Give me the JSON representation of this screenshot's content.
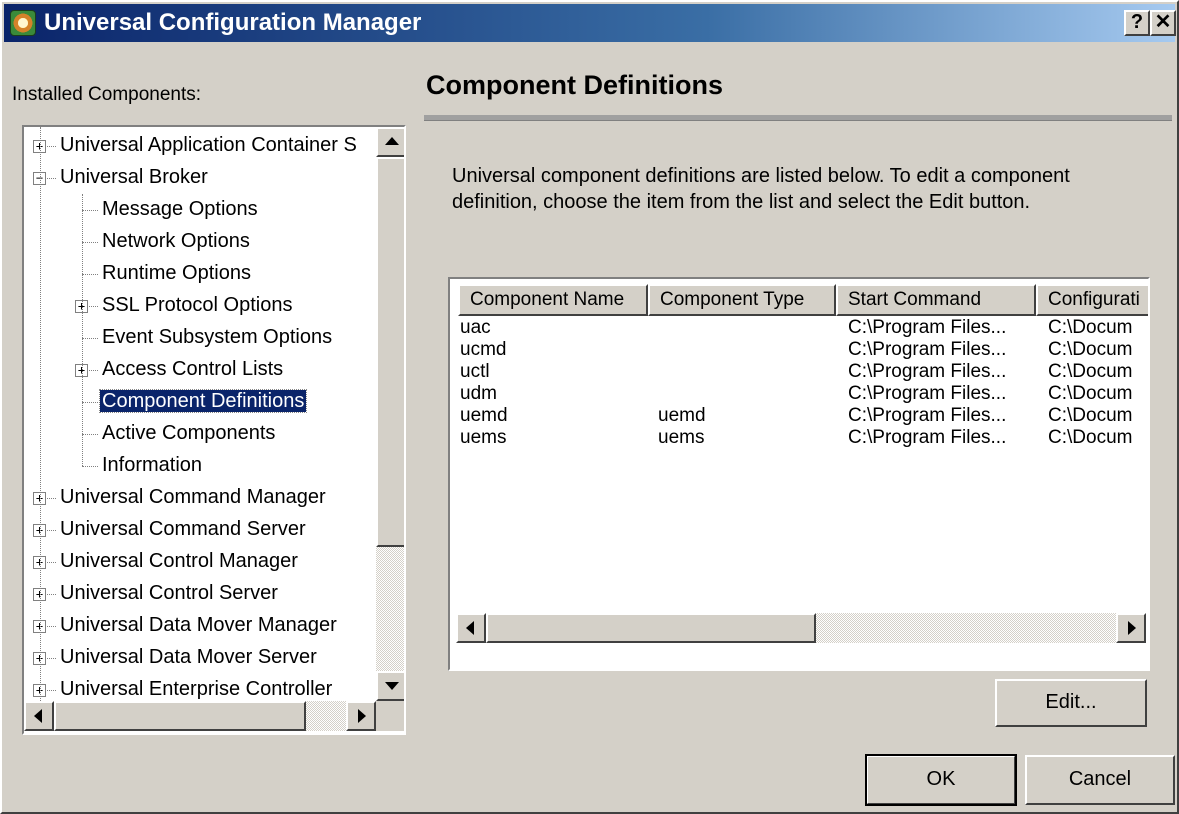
{
  "window": {
    "title": "Universal Configuration Manager",
    "help_button": "?",
    "close_button": "✕"
  },
  "left_panel": {
    "label": "Installed Components:",
    "tree": [
      {
        "label": "Universal Application Container S",
        "level": 0,
        "expander": "+",
        "selected": false
      },
      {
        "label": "Universal Broker",
        "level": 0,
        "expander": "−",
        "selected": false
      },
      {
        "label": "Message Options",
        "level": 1,
        "expander": null,
        "selected": false
      },
      {
        "label": "Network Options",
        "level": 1,
        "expander": null,
        "selected": false
      },
      {
        "label": "Runtime Options",
        "level": 1,
        "expander": null,
        "selected": false
      },
      {
        "label": "SSL Protocol Options",
        "level": 1,
        "expander": "+",
        "selected": false
      },
      {
        "label": "Event Subsystem Options",
        "level": 1,
        "expander": null,
        "selected": false
      },
      {
        "label": "Access Control Lists",
        "level": 1,
        "expander": "+",
        "selected": false
      },
      {
        "label": "Component Definitions",
        "level": 1,
        "expander": null,
        "selected": true
      },
      {
        "label": "Active Components",
        "level": 1,
        "expander": null,
        "selected": false
      },
      {
        "label": "Information",
        "level": 1,
        "expander": null,
        "selected": false
      },
      {
        "label": "Universal Command Manager",
        "level": 0,
        "expander": "+",
        "selected": false
      },
      {
        "label": "Universal Command Server",
        "level": 0,
        "expander": "+",
        "selected": false
      },
      {
        "label": "Universal Control Manager",
        "level": 0,
        "expander": "+",
        "selected": false
      },
      {
        "label": "Universal Control Server",
        "level": 0,
        "expander": "+",
        "selected": false
      },
      {
        "label": "Universal Data Mover Manager",
        "level": 0,
        "expander": "+",
        "selected": false
      },
      {
        "label": "Universal Data Mover Server",
        "level": 0,
        "expander": "+",
        "selected": false
      },
      {
        "label": "Universal Enterprise Controller",
        "level": 0,
        "expander": "+",
        "selected": false
      }
    ]
  },
  "main": {
    "heading": "Component Definitions",
    "description": "Universal component definitions are listed below.  To edit a component definition, choose the item from the list and select the Edit button.",
    "columns": [
      "Component Name",
      "Component Type",
      "Start Command",
      "Configurati"
    ],
    "rows": [
      [
        "uac",
        "",
        "C:\\Program Files...",
        "C:\\Docum"
      ],
      [
        "ucmd",
        "",
        "C:\\Program Files...",
        "C:\\Docum"
      ],
      [
        "uctl",
        "",
        "C:\\Program Files...",
        "C:\\Docum"
      ],
      [
        "udm",
        "",
        "C:\\Program Files...",
        "C:\\Docum"
      ],
      [
        "uemd",
        "uemd",
        "C:\\Program Files...",
        "C:\\Docum"
      ],
      [
        "uems",
        "uems",
        "C:\\Program Files...",
        "C:\\Docum"
      ]
    ],
    "edit_button": "Edit..."
  },
  "footer": {
    "ok_button": "OK",
    "cancel_button": "Cancel"
  }
}
